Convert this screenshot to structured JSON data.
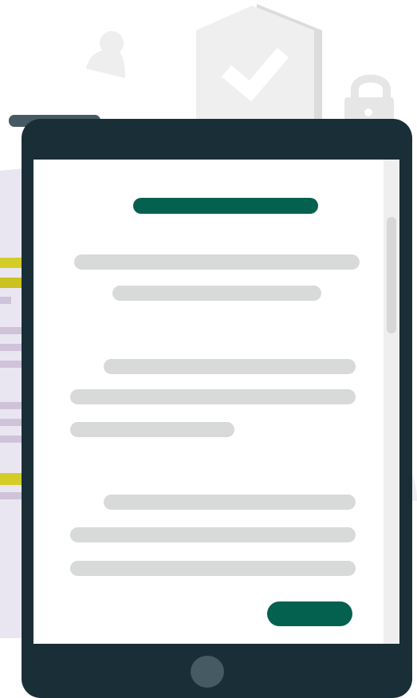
{
  "illustration": {
    "subject": "tablet-form-security",
    "icons": [
      "user-icon",
      "shield-check-icon",
      "padlock-icon"
    ],
    "colors": {
      "tablet_frame": "#1a2e37",
      "top_bar": "#465a64",
      "home_button": "#465a64",
      "accent": "#04614f",
      "placeholder": "#d8d9d9",
      "scrollbar_track": "#efefef",
      "scrollbar_thumb": "#d7d7d7",
      "background_document": "#e9e6f1",
      "highlight_yellow": "#d4cd28",
      "highlight_purple": "#cfc2d9",
      "background_icons": "#eeeeee"
    }
  }
}
